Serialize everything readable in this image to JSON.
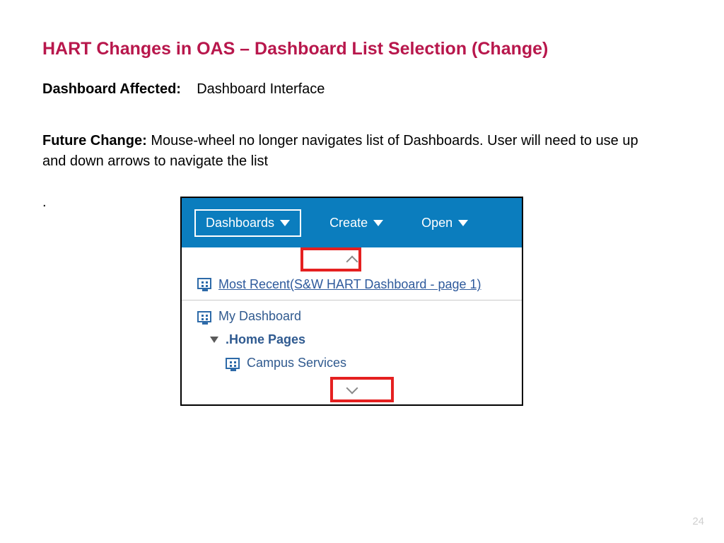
{
  "title": "HART Changes in OAS – Dashboard List Selection (Change)",
  "affected": {
    "label": "Dashboard Affected:",
    "value": "Dashboard Interface"
  },
  "future": {
    "label": "Future Change:",
    "text": "Mouse-wheel no longer navigates list of Dashboards. User will need to use up and down arrows to navigate the list"
  },
  "stray": ".",
  "page_number": "24",
  "screenshot": {
    "menu": {
      "dashboards": "Dashboards",
      "create": "Create",
      "open": "Open"
    },
    "dropdown": {
      "most_recent": "Most Recent(S&W HART Dashboard - page 1)",
      "my_dashboard": "My Dashboard",
      "home_pages": ".Home Pages",
      "campus_services": "Campus Services"
    }
  }
}
